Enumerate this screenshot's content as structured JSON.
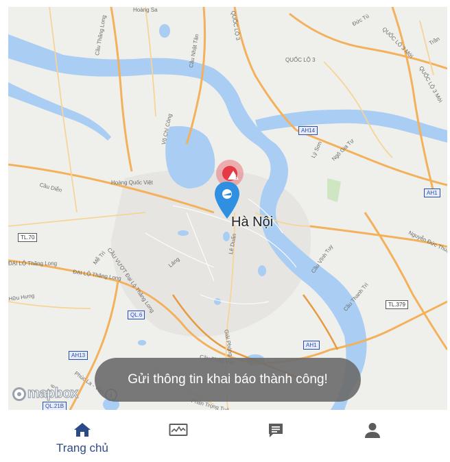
{
  "map": {
    "city_label": "Hà Nội",
    "labels": {
      "hoang_sa": "Hoàng Sa",
      "cau_thang_long": "Cầu Thăng Long",
      "cau_nhat_tan": "Cầu Nhật Tân",
      "vo_chi_cong": "Võ Chí Công",
      "quoc_lo_3_top": "QUỐC LỘ 3",
      "quoc_lo_3_right": "QUỐC LỘ 3",
      "quoc_lo_3_mid": "QUỐC LỘ 3",
      "duc_tu": "Đức Tú",
      "quoc_lo_3_moi": "QUỐC LỘ 3 Mới",
      "quoc_lo_3_moi_2": "QUỐC LỘ 3 Mới",
      "tran": "Trần",
      "ly_son": "Lý Sơn",
      "ngo_gia_tu": "Ngô Gia Tự",
      "cau_dien": "Cầu Diễn",
      "hoang_quoc_viet": "Hoàng Quốc Việt",
      "nguyen_duc_thuan": "Nguyễn Đức Thuận",
      "le_duan": "Lê Duẩn",
      "cau_vinh_tuy": "Cầu Vĩnh Tuy",
      "dai_lo_thang_long": "ĐẠI LỘ Thăng Long",
      "dai_lo_thang_long_2": "ĐẠI LỘ Thăng Long",
      "me_tri": "Mễ Trì",
      "cau_vuot": "CẦU VƯỢT Đại Lộ Thăng Long",
      "lang": "Láng",
      "huu_hung": "Hữu Hưng",
      "cau_thanh_tri": "Cầu Thanh Trì",
      "giai_phong": "Giải Phóng",
      "cau_phap_van": "Cầu Pháp Vân",
      "phuc_la_van_phuc": "Phúc La - Văn Phúc",
      "phan_trong_tue": "Phan Trọng Tuệ",
      "ql6_label": "QL 6"
    },
    "shields": {
      "ah14": "AH14",
      "ah1_right": "AH1",
      "tl70": "TL.70",
      "tl379": "TL.379",
      "ql6": "QL.6",
      "ah1_bottom": "AH1",
      "ah13": "AH13",
      "ql21b": "QL.21B"
    },
    "attribution": "mapbox",
    "info_glyph": "i"
  },
  "toast": {
    "message": "Gửi thông tin khai báo thành công!"
  },
  "bottom_nav": {
    "items": [
      {
        "label": "Trang chủ",
        "icon": "home-icon",
        "active": true
      },
      {
        "label": "",
        "icon": "monitor-chart-icon",
        "active": false
      },
      {
        "label": "",
        "icon": "feedback-icon",
        "active": false
      },
      {
        "label": "",
        "icon": "person-icon",
        "active": false
      }
    ]
  },
  "colors": {
    "water": "#a9cdf3",
    "road_major": "#f2b15a",
    "road_minor": "#f7d496",
    "nav_active": "#2b4a87",
    "nav_inactive": "#5c5c5c",
    "pin": "#2f8fe0",
    "warning": "#e53945",
    "toast_bg": "#6e6e6e"
  }
}
